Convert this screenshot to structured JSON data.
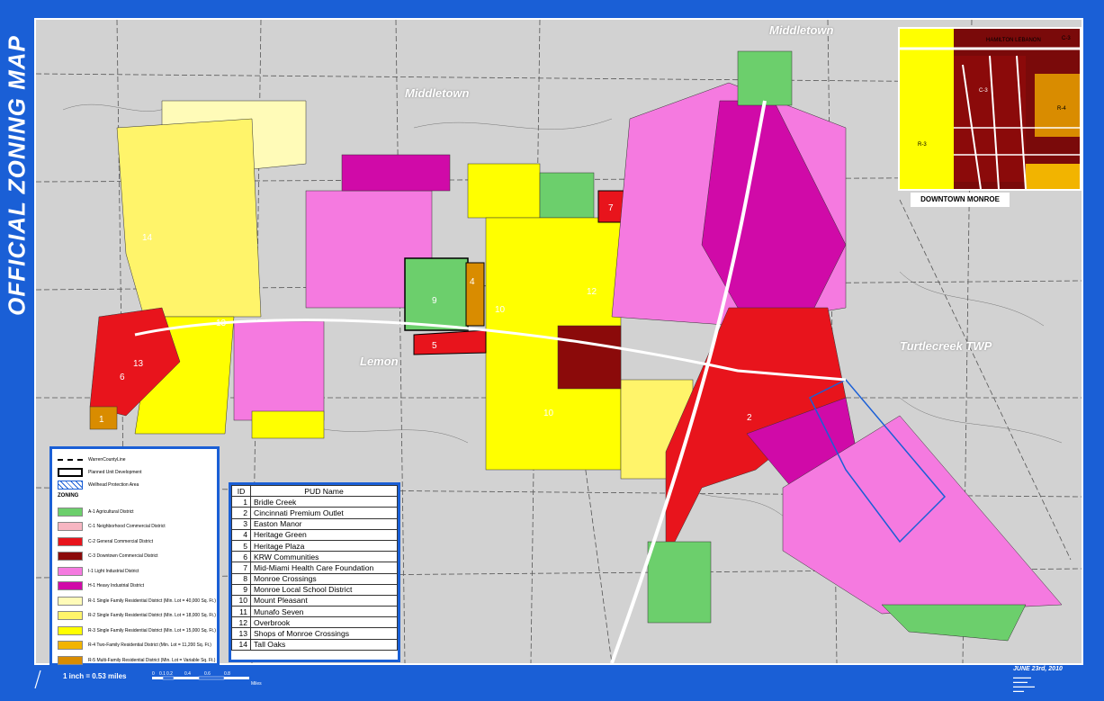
{
  "title": "OFFICIAL ZONING MAP",
  "places": {
    "middletown_top": "Middletown",
    "middletown_left": "Middletown",
    "lemon": "Lemon",
    "turtlecreek": "Turtlecreek TWP"
  },
  "inset": {
    "caption": "DOWNTOWN MONROE",
    "road": "HAMILTON LEBANON",
    "labels": [
      "C-3",
      "R-3",
      "R-4",
      "C-3"
    ]
  },
  "legend": {
    "county_line": "WarrenCountyLine",
    "pud": "Planned Unit Development",
    "wellhead": "Wellhead Protection Area",
    "zoning_header": "ZONING",
    "items": [
      {
        "label": "A-1 Agricultural District",
        "color": "#6ccf6c"
      },
      {
        "label": "C-1 Neighborhood Commercial District",
        "color": "#f7b6c2"
      },
      {
        "label": "C-2 General Commercial District",
        "color": "#e8141c"
      },
      {
        "label": "C-3 Downtown Commercial District",
        "color": "#8b0a0a"
      },
      {
        "label": "I-1 Light Industrial District",
        "color": "#f57ae0"
      },
      {
        "label": "H-1 Heavy Industrial District",
        "color": "#d00aa8"
      },
      {
        "label": "R-1 Single Family Residential District (Min. Lot = 40,000 Sq. Ft.)",
        "color": "#fffbb8"
      },
      {
        "label": "R-2 Single Family Residential District (Min. Lot = 18,000 Sq. Ft.)",
        "color": "#fff46a"
      },
      {
        "label": "R-3 Single Family Residential District (Min. Lot = 15,000 Sq. Ft.)",
        "color": "#ffff00"
      },
      {
        "label": "R-4 Two-Family Residential District (Min. Lot = 11,200 Sq. Ft.)",
        "color": "#f2b400"
      },
      {
        "label": "R-5 Multi-Family Residential District (Min. Lot = Variable Sq. Ft.)",
        "color": "#d98c00"
      }
    ]
  },
  "pud_table": {
    "headers": [
      "ID",
      "PUD Name"
    ],
    "rows": [
      [
        "1",
        "Bridle Creek"
      ],
      [
        "2",
        "Cincinnati Premium Outlet"
      ],
      [
        "3",
        "Easton Manor"
      ],
      [
        "4",
        "Heritage Green"
      ],
      [
        "5",
        "Heritage Plaza"
      ],
      [
        "6",
        "KRW Communities"
      ],
      [
        "7",
        "Mid-Miami Health Care Foundation"
      ],
      [
        "8",
        "Monroe Crossings"
      ],
      [
        "9",
        "Monroe Local School District"
      ],
      [
        "10",
        "Mount Pleasant"
      ],
      [
        "11",
        "Munafo Seven"
      ],
      [
        "12",
        "Overbrook"
      ],
      [
        "13",
        "Shops of Monroe Crossings"
      ],
      [
        "14",
        "Tall Oaks"
      ]
    ]
  },
  "map_labels": [
    "14",
    "13",
    "13",
    "6",
    "1",
    "5",
    "9",
    "4",
    "10",
    "12",
    "7",
    "2",
    "10"
  ],
  "scale": {
    "text": "1 inch = 0.53 miles",
    "ticks": [
      "0",
      "0.1",
      "0.2",
      "0.4",
      "0.6",
      "0.8"
    ],
    "unit": "Miles"
  },
  "date": "JUNE 23rd, 2010",
  "colors": {
    "frame": "#1a5fd6",
    "background": "#d2d2d2"
  }
}
